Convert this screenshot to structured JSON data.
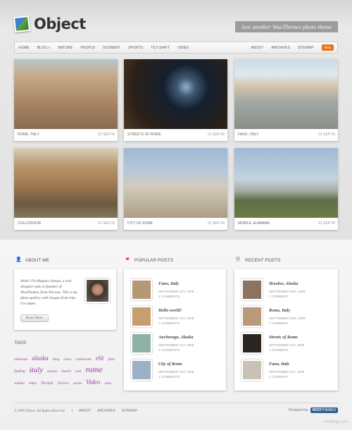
{
  "site": {
    "title": "Object",
    "tagline": "Just another WooThemes photo theme"
  },
  "nav": {
    "left": [
      "HOME",
      "BLOG »",
      "NATURE",
      "PEOPLE",
      "SCENERY",
      "SPORTS",
      "TILT-SHIFT",
      "VIDEO"
    ],
    "right": [
      "ABOUT",
      "ARCHIVES",
      "SITEMAP"
    ],
    "rss": "RSS"
  },
  "gallery": [
    {
      "caption": "ROME, ITALY",
      "date": "02 SEP 09"
    },
    {
      "caption": "STREETS OF ROME",
      "date": "01 SEP 09"
    },
    {
      "caption": "FANO, ITALY",
      "date": "01 SEP 09"
    },
    {
      "caption": "COLLOSSIUM",
      "date": "01 SEP 09"
    },
    {
      "caption": "CITY OF ROME",
      "date": "01 SEP 09"
    },
    {
      "caption": "MOBILE, ALABAMA",
      "date": "01 SEP 09"
    }
  ],
  "about": {
    "heading": "ABOUT ME",
    "text": "Hello! I'm Magnus Jepson, a web designer and co-founder of WooThemes, from Norway. This is my photo gallery with images from trips I've taken.",
    "readmore": "Read More"
  },
  "tags": {
    "heading": "TAGS",
    "items": [
      {
        "text": "alabama",
        "size": 5.5
      },
      {
        "text": "alaska",
        "size": 9
      },
      {
        "text": "blog",
        "size": 5.5
      },
      {
        "text": "class",
        "size": 5.5
      },
      {
        "text": "colloseum",
        "size": 5.5
      },
      {
        "text": "elit",
        "size": 9
      },
      {
        "text": "fano",
        "size": 5.5
      },
      {
        "text": "finding",
        "size": 5.5
      },
      {
        "text": "italy",
        "size": 11
      },
      {
        "text": "masses",
        "size": 5
      },
      {
        "text": "mauris",
        "size": 5
      },
      {
        "text": "post",
        "size": 5
      },
      {
        "text": "rome",
        "size": 12
      },
      {
        "text": "sodales",
        "size": 5
      },
      {
        "text": "tellus",
        "size": 5
      },
      {
        "text": "Tilt-Shift",
        "size": 5
      },
      {
        "text": "Ultrices",
        "size": 5
      },
      {
        "text": "varius",
        "size": 5
      },
      {
        "text": "Video",
        "size": 9
      },
      {
        "text": "vitae",
        "size": 5
      }
    ]
  },
  "popular": {
    "heading": "POPULAR POSTS",
    "posts": [
      {
        "title": "Fano, Italy",
        "date": "SEPTEMBER 1ST, 2009",
        "comments": "2 COMMENTS",
        "color": "#b59874"
      },
      {
        "title": "Hello world!",
        "date": "SEPTEMBER 1ST, 2009",
        "comments": "1 COMMENTS",
        "color": "#c79e70"
      },
      {
        "title": "Anchorage, Alaska",
        "date": "SEPTEMBER 1ST, 2009",
        "comments": "1 COMMENTS",
        "color": "#8fb1a6"
      },
      {
        "title": "City of Rome",
        "date": "SEPTEMBER 1ST, 2009",
        "comments": "1 COMMENTS",
        "color": "#9cb0c6"
      }
    ]
  },
  "recent": {
    "heading": "RECENT POSTS",
    "posts": [
      {
        "title": "Hoodoo, Alaska",
        "date": "SEPTEMBER 3RD, 2009",
        "comments": "1 COMMENT",
        "color": "#8c7260"
      },
      {
        "title": "Rome, Italy",
        "date": "SEPTEMBER 2ND, 2009",
        "comments": "1 COMMENT",
        "color": "#b89a78"
      },
      {
        "title": "Streets of Rome",
        "date": "SEPTEMBER 1ST, 2009",
        "comments": "1 COMMENT",
        "color": "#2a2520"
      },
      {
        "title": "Fano, Italy",
        "date": "SEPTEMBER 1ST, 2009",
        "comments": "1 COMMENT",
        "color": "#c9c2b4"
      }
    ]
  },
  "footer": {
    "copyright": "© 2009 Object. All Rights Reserved.",
    "separator": "|",
    "links": [
      "ABOUT",
      "ARCHIVES",
      "SITEMAP"
    ],
    "designed_by": "Designed by",
    "designer_a": "WOO",
    "designer_b": "THEMES"
  },
  "watermark": "vn2blog.com"
}
